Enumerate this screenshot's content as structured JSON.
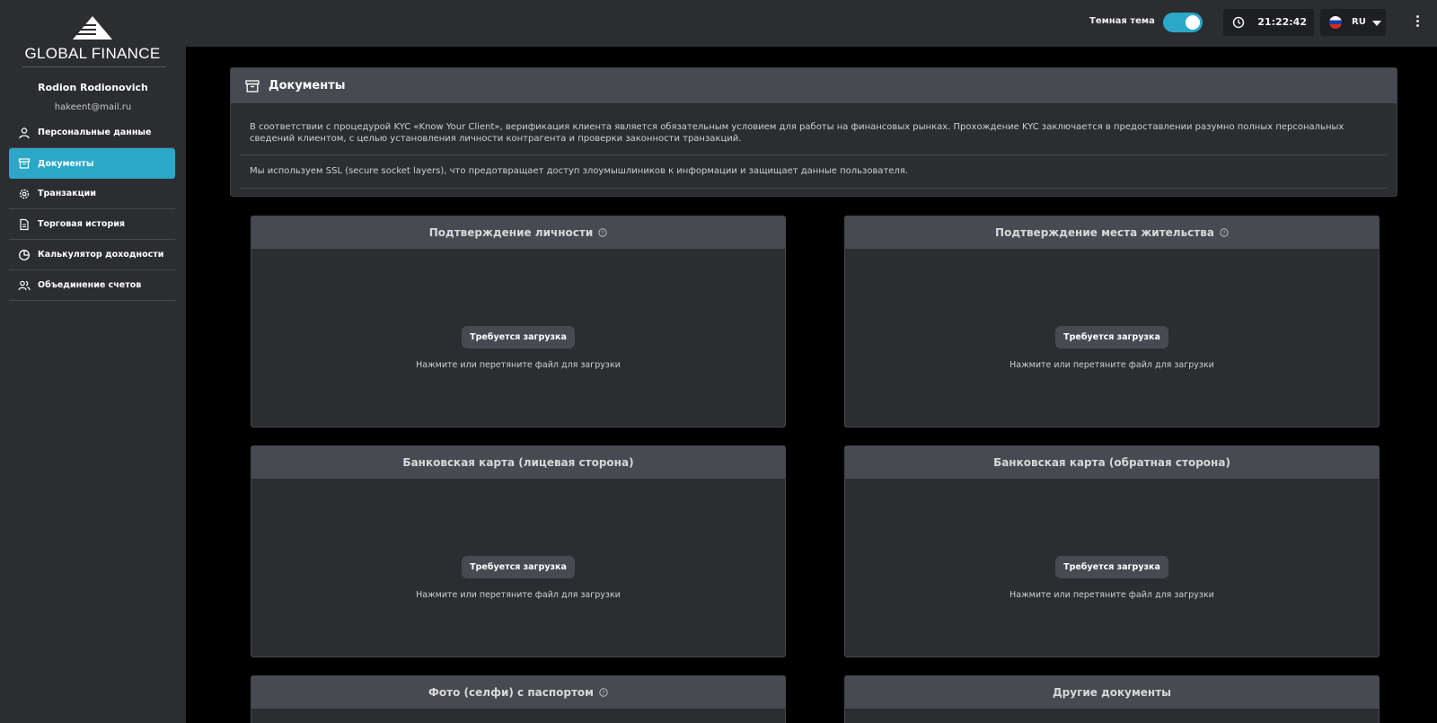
{
  "brand": {
    "name": "GLOBAL FINANCE"
  },
  "user": {
    "name": "Rodion  Rodionovich",
    "email": "hakeent@mail.ru"
  },
  "topbar": {
    "theme_label": "Темная тема",
    "theme_on": true,
    "time": "21:22:42",
    "language": "RU"
  },
  "nav": {
    "items": [
      {
        "label": "Персональные данные",
        "icon": "user-icon"
      },
      {
        "label": "Документы",
        "icon": "archive-icon",
        "active": true
      },
      {
        "label": "Транзакции",
        "icon": "gear-icon"
      },
      {
        "label": "Торговая история",
        "icon": "document-icon"
      },
      {
        "label": "Калькулятор доходности",
        "icon": "pie-chart-icon"
      },
      {
        "label": "Объединение счетов",
        "icon": "users-icon"
      }
    ]
  },
  "info": {
    "title": "Документы",
    "paragraph1": "В соответствии с процедурой KYC «Know Your Client», верификация клиента является обязательным условием для работы на финансовых рынках. Прохождение KYC заключается в предоставлении разумно полных персональных сведений клиентом, с целью установления личности контрагента и проверки законности транзакций.",
    "paragraph2": "Мы используем SSL (secure socket layers), что предотвращает доступ злоумышлиников к информации и защищает данные пользователя."
  },
  "documents": [
    {
      "title": "Подтверждение личности",
      "help": true,
      "button": "Требуется загрузка",
      "hint": "Нажмите или перетяните файл для загрузки"
    },
    {
      "title": "Подтверждение места жительства",
      "help": true,
      "button": "Требуется загрузка",
      "hint": "Нажмите или перетяните файл для загрузки"
    },
    {
      "title": "Банковская карта (лицевая сторона)",
      "help": false,
      "button": "Требуется загрузка",
      "hint": "Нажмите или перетяните файл для загрузки"
    },
    {
      "title": "Банковская карта (обратная сторона)",
      "help": false,
      "button": "Требуется загрузка",
      "hint": "Нажмите или перетяните файл для загрузки"
    },
    {
      "title": "Фото (селфи) с паспортом",
      "help": true
    },
    {
      "title": "Другие документы",
      "help": false
    }
  ],
  "colors": {
    "accent": "#2ca7c8",
    "panel": "#2b2d31",
    "header": "#474a50",
    "background": "#000000"
  }
}
